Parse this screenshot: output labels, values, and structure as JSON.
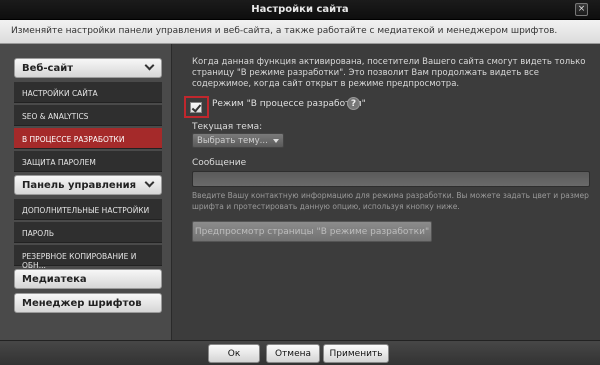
{
  "window": {
    "title": "Настройки сайта",
    "close_symbol": "×"
  },
  "description": "Изменяйте настройки панели управления и веб-сайта, а также работайте с медиатекой и менеджером шрифтов.",
  "sidebar": {
    "groups": [
      {
        "label": "Веб-сайт",
        "expanded": true,
        "items": [
          {
            "label": "НАСТРОЙКИ САЙТА",
            "active": false
          },
          {
            "label": "SEO & ANALYTICS",
            "active": false
          },
          {
            "label": "В ПРОЦЕССЕ РАЗРАБОТКИ",
            "active": true
          },
          {
            "label": "ЗАЩИТА ПАРОЛЕМ",
            "active": false
          }
        ]
      },
      {
        "label": "Панель управления",
        "expanded": true,
        "items": [
          {
            "label": "ДОПОЛНИТЕЛЬНЫЕ НАСТРОЙКИ",
            "active": false
          },
          {
            "label": "ПАРОЛЬ",
            "active": false
          },
          {
            "label": "РЕЗЕРВНОЕ КОПИРОВАНИЕ И ОБН...",
            "active": false
          }
        ]
      },
      {
        "label": "Медиатека",
        "expanded": false,
        "items": []
      },
      {
        "label": "Менеджер шрифтов",
        "expanded": false,
        "items": []
      }
    ]
  },
  "main": {
    "description": "Когда данная функция активирована, посетители Вашего сайта смогут видеть только страницу \"В режиме разработки\". Это позволит Вам продолжать видеть все содержимое, когда сайт открыт в режиме предпросмотра.",
    "checkbox_label": "Режим \"В процессе разработки\"",
    "checkbox_checked": true,
    "help_symbol": "?",
    "theme_label": "Текущая тема:",
    "theme_selected": "Выбрать тему...",
    "message_label": "Сообщение",
    "message_value": "",
    "hint": "Введите Вашу контактную информацию для режима разработки. Вы можете задать цвет и размер шрифта и протестировать данную опцию, используя кнопку ниже.",
    "preview_button": "Предпросмотр страницы \"В режиме разработки\""
  },
  "footer": {
    "ok": "Ок",
    "cancel": "Отмена",
    "apply": "Применить"
  },
  "colors": {
    "accent_active": "#a52a2a",
    "highlight_box": "#c0272d"
  }
}
